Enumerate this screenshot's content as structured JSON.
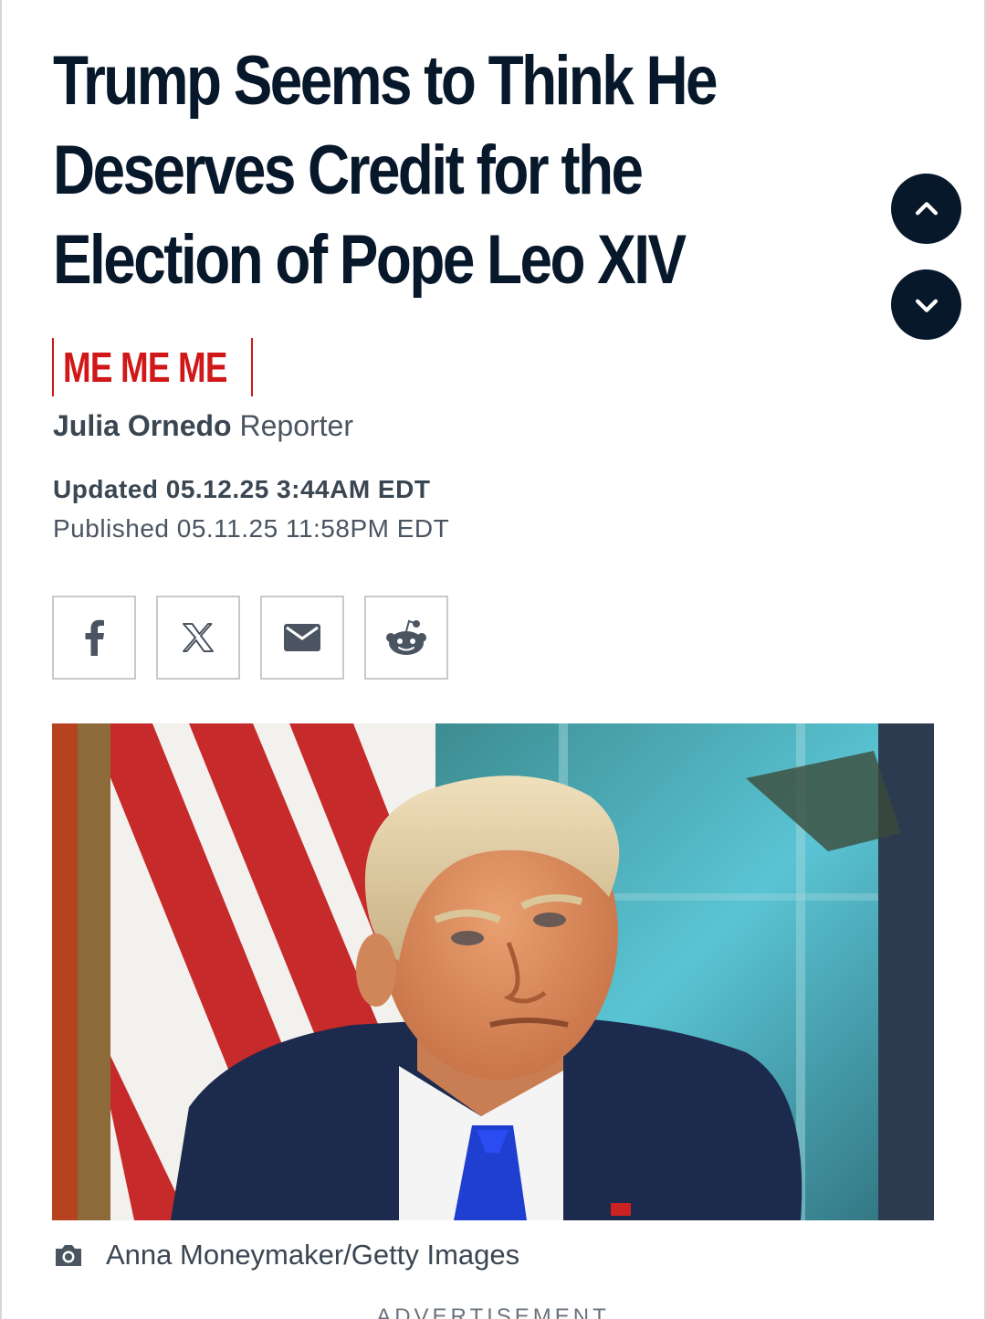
{
  "article": {
    "headline_lines": [
      "Trump Seems to Think He",
      "Deserves Credit for the",
      "Election of Pope Leo XIV"
    ],
    "section_tag": "ME ME ME",
    "author": "Julia Ornedo",
    "author_role": "Reporter",
    "updated": "Updated 05.12.25 3:44AM EDT",
    "published": "Published 05.11.25 11:58PM EDT",
    "photo_credit": "Anna Moneymaker/Getty Images",
    "ad_label": "ADVERTISEMENT"
  },
  "share": [
    {
      "icon": "facebook-icon"
    },
    {
      "icon": "x-icon"
    },
    {
      "icon": "email-icon"
    },
    {
      "icon": "reddit-icon"
    }
  ],
  "nav": {
    "up_icon": "chevron-up-icon",
    "down_icon": "chevron-down-icon"
  },
  "colors": {
    "headline": "#07182b",
    "accent_red": "#d01818",
    "meta_text": "#3a4652",
    "border": "#c9c9c9"
  }
}
